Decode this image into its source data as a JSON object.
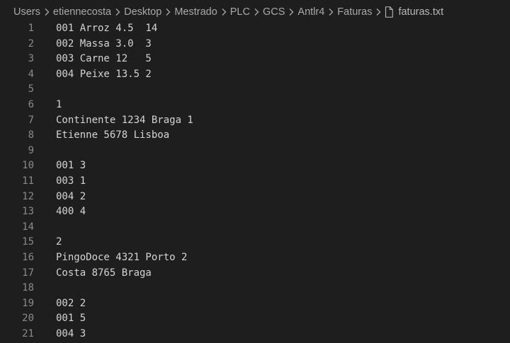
{
  "breadcrumb": {
    "items": [
      "Users",
      "etiennecosta",
      "Desktop",
      "Mestrado",
      "PLC",
      "GCS",
      "Antlr4",
      "Faturas"
    ],
    "file": "faturas.txt",
    "file_icon": "file-icon"
  },
  "editor": {
    "lines": [
      {
        "num": "1",
        "text": "001 Arroz 4.5  14"
      },
      {
        "num": "2",
        "text": "002 Massa 3.0  3"
      },
      {
        "num": "3",
        "text": "003 Carne 12   5"
      },
      {
        "num": "4",
        "text": "004 Peixe 13.5 2"
      },
      {
        "num": "5",
        "text": ""
      },
      {
        "num": "6",
        "text": "1"
      },
      {
        "num": "7",
        "text": "Continente 1234 Braga 1"
      },
      {
        "num": "8",
        "text": "Etienne 5678 Lisboa"
      },
      {
        "num": "9",
        "text": ""
      },
      {
        "num": "10",
        "text": "001 3"
      },
      {
        "num": "11",
        "text": "003 1"
      },
      {
        "num": "12",
        "text": "004 2"
      },
      {
        "num": "13",
        "text": "400 4"
      },
      {
        "num": "14",
        "text": ""
      },
      {
        "num": "15",
        "text": "2"
      },
      {
        "num": "16",
        "text": "PingoDoce 4321 Porto 2"
      },
      {
        "num": "17",
        "text": "Costa 8765 Braga"
      },
      {
        "num": "18",
        "text": ""
      },
      {
        "num": "19",
        "text": "002 2"
      },
      {
        "num": "20",
        "text": "001 5"
      },
      {
        "num": "21",
        "text": "004 3"
      }
    ]
  }
}
